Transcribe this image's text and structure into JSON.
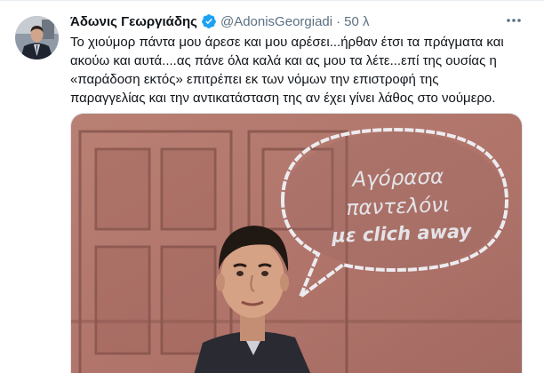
{
  "tweet": {
    "author_name": "Άδωνις Γεωργιάδης",
    "handle": "@AdonisGeorgiadi",
    "separator": "·",
    "time": "50 λ",
    "more_icon": "more-horizontal-icon",
    "verified_icon": "verified-badge-icon",
    "text_lines": [
      "Το χιούμορ πάντα μου άρεσε και μου αρέσει...ήρθαν έτσι τα πράγματα και",
      "ακούω και αυτά....ας πάνε όλα καλά και ας μου τα λέτε...επί της ουσίας η",
      "«παράδοση εκτός» επιτρέπει εκ των νόμων την επιστροφή της",
      "παραγγελίας και την αντικατάσταση της αν έχει γίνει λάθος στο νούμερο."
    ]
  },
  "media": {
    "speech_bubble_lines": [
      "Αγόρασα",
      "παντελόνι",
      "με clich away"
    ]
  },
  "colors": {
    "text_primary": "#0f1419",
    "text_secondary": "#5b7083",
    "verified": "#1da1f2",
    "wall": "#b5776d",
    "bubble_text": "#e4e4e8"
  }
}
